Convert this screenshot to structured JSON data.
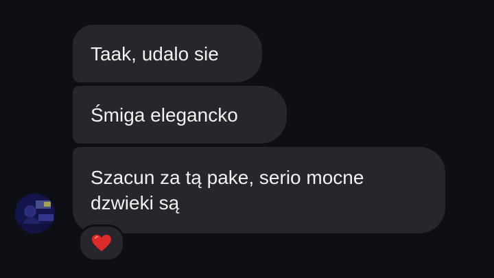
{
  "messages": [
    {
      "text": "Taak, udalo sie"
    },
    {
      "text": "Śmiga elegancko"
    },
    {
      "text": "Szacun za tą pake, serio mocne dzwieki są"
    }
  ],
  "reaction": {
    "icon": "heart-icon",
    "color": "#e02a2a"
  },
  "colors": {
    "background": "#0e0f14",
    "bubble": "#26262c",
    "text": "#f2f2f2"
  }
}
